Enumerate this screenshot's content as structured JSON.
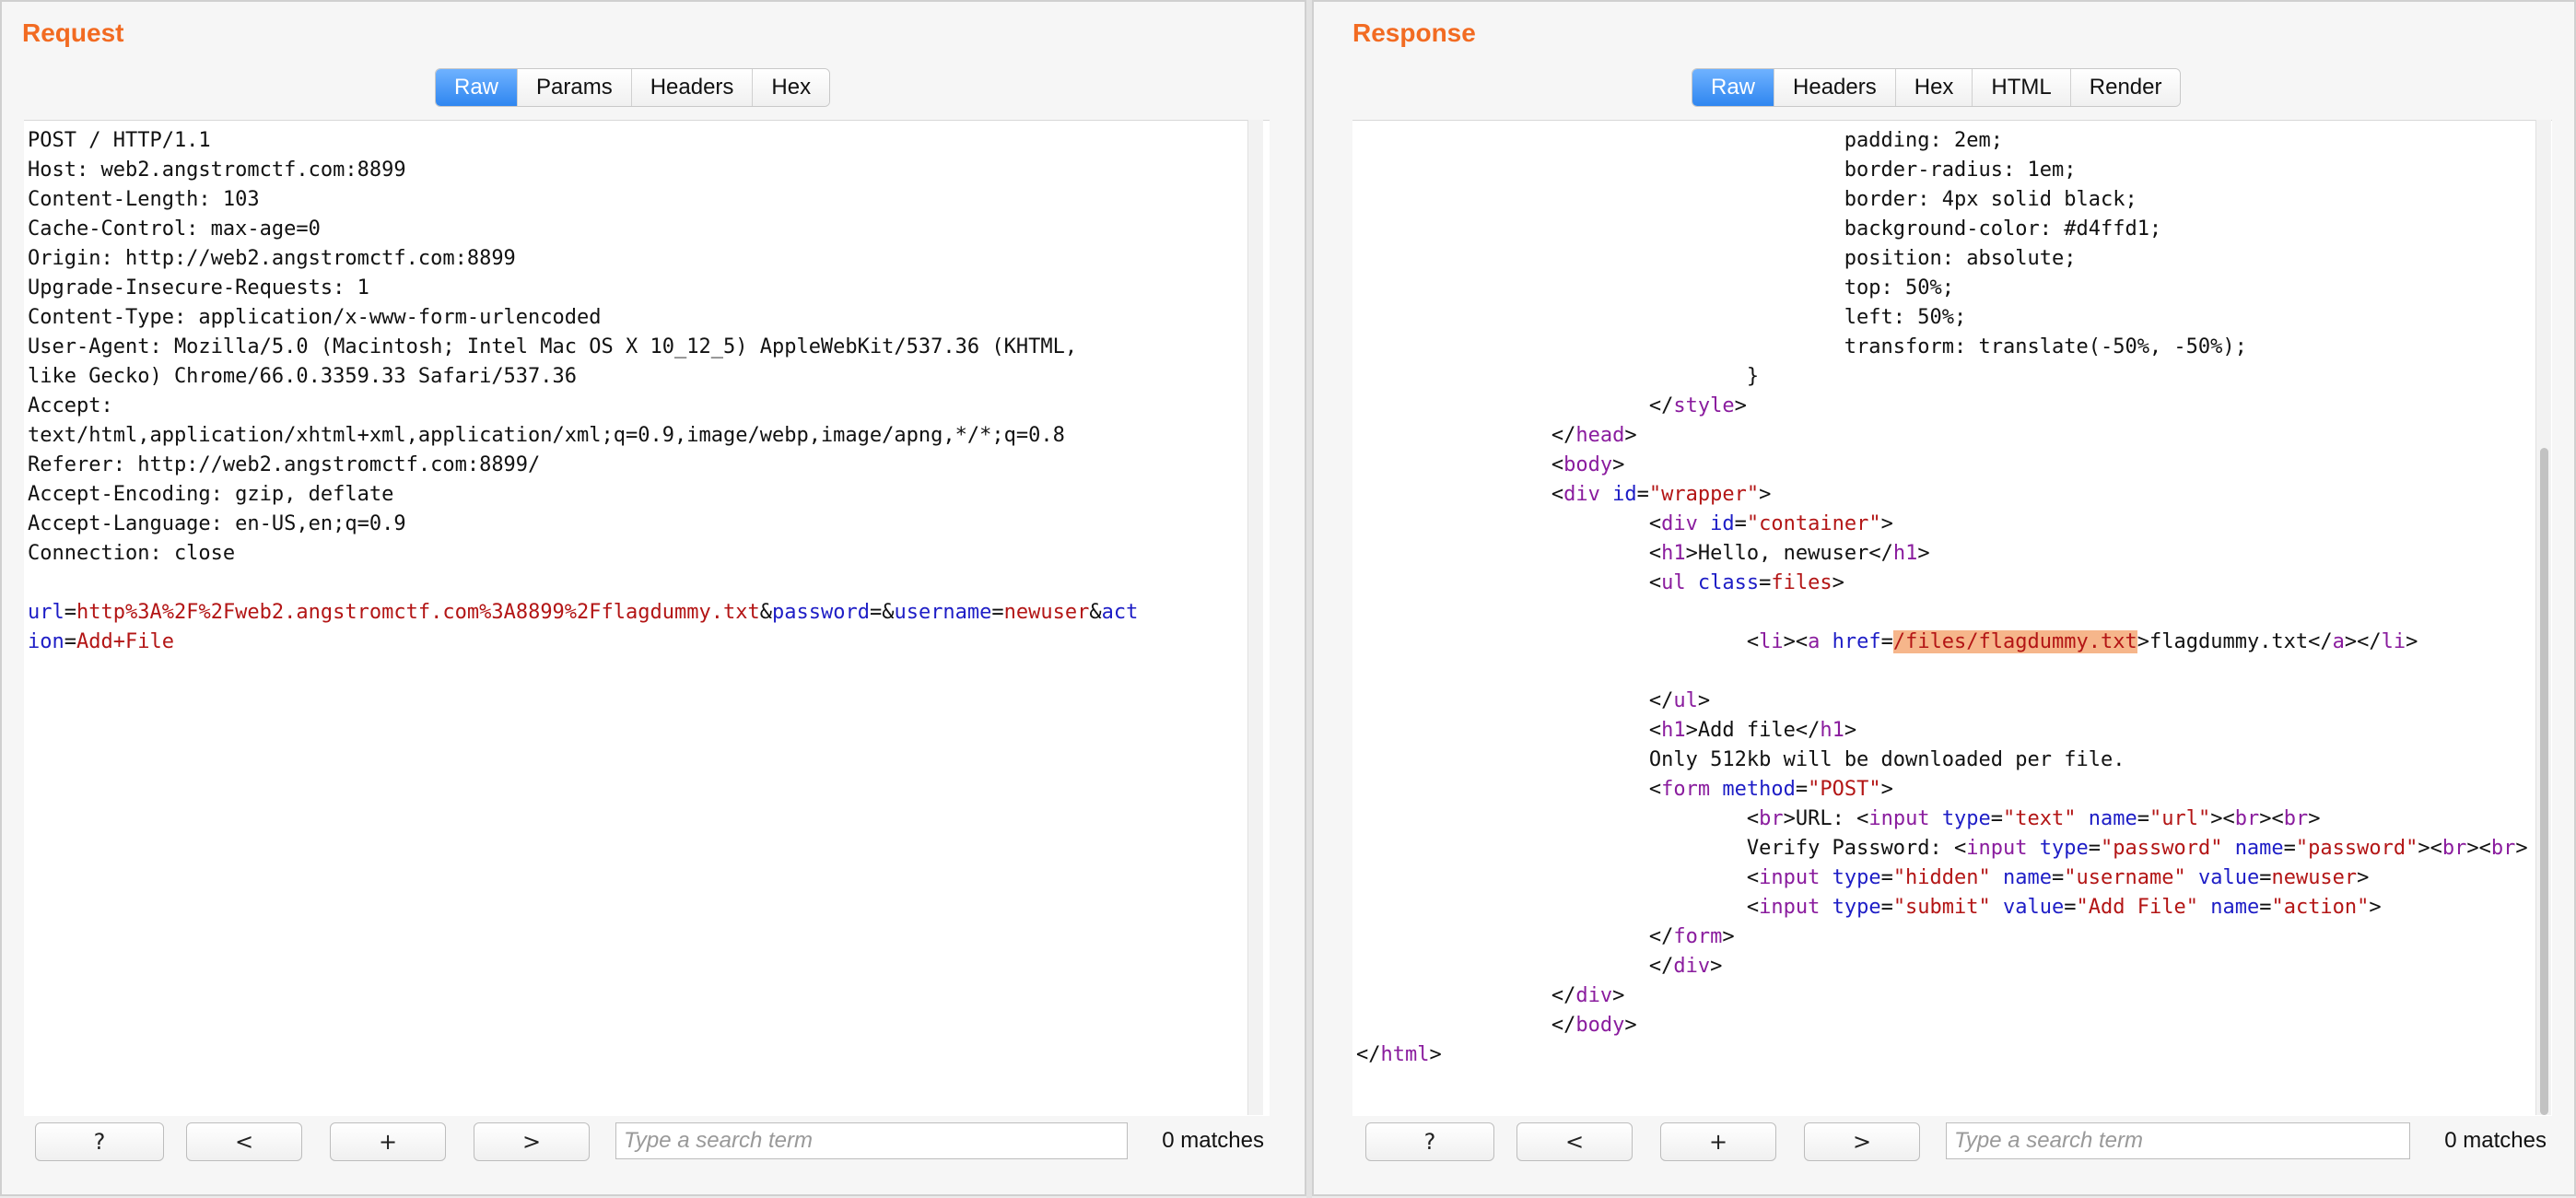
{
  "request": {
    "title": "Request",
    "tabs": [
      "Raw",
      "Params",
      "Headers",
      "Hex"
    ],
    "active_tab": "Raw",
    "lines": [
      "POST / HTTP/1.1",
      "Host: web2.angstromctf.com:8899",
      "Content-Length: 103",
      "Cache-Control: max-age=0",
      "Origin: http://web2.angstromctf.com:8899",
      "Upgrade-Insecure-Requests: 1",
      "Content-Type: application/x-www-form-urlencoded",
      "User-Agent: Mozilla/5.0 (Macintosh; Intel Mac OS X 10_12_5) AppleWebKit/537.36 (KHTML,",
      "like Gecko) Chrome/66.0.3359.33 Safari/537.36",
      "Accept:",
      "text/html,application/xhtml+xml,application/xml;q=0.9,image/webp,image/apng,*/*;q=0.8",
      "Referer: http://web2.angstromctf.com:8899/",
      "Accept-Encoding: gzip, deflate",
      "Accept-Language: en-US,en;q=0.9",
      "Connection: close",
      ""
    ],
    "body": {
      "p1_name": "url",
      "p1_value": "http%3A%2F%2Fweb2.angstromctf.com%3A8899%2Fflagdummy.txt",
      "p2_name": "password",
      "p2_value": "",
      "p3_name": "username",
      "p3_value": "newuser",
      "p4_name_a": "act",
      "p4_name_b": "ion",
      "p4_value": "Add+File"
    },
    "help_label": "?",
    "prev_label": "<",
    "add_label": "+",
    "next_label": ">",
    "search_placeholder": "Type a search term",
    "matches": "0 matches"
  },
  "response": {
    "title": "Response",
    "tabs": [
      "Raw",
      "Headers",
      "Hex",
      "HTML",
      "Render"
    ],
    "active_tab": "Raw",
    "css_lines": [
      "                                        padding: 2em;",
      "                                        border-radius: 1em;",
      "                                        border: 4px solid black;",
      "                                        background-color: #d4ffd1;",
      "                                        position: absolute;",
      "                                        top: 50%;",
      "                                        left: 50%;",
      "                                        transform: translate(-50%, -50%);",
      "                                }"
    ],
    "text_hello": "Hello, newuser",
    "file_href": "/files/flagdummy.txt",
    "file_name": "flagdummy.txt",
    "text_add_file": "Add file",
    "text_limit": "Only 512kb will be downloaded per file.",
    "text_url": "URL: ",
    "text_verify": "Verify Password: ",
    "hidden_username": "newuser",
    "submit_value": "\"Add File\"",
    "help_label": "?",
    "prev_label": "<",
    "add_label": "+",
    "next_label": ">",
    "search_placeholder": "Type a search term",
    "matches": "0 matches"
  }
}
